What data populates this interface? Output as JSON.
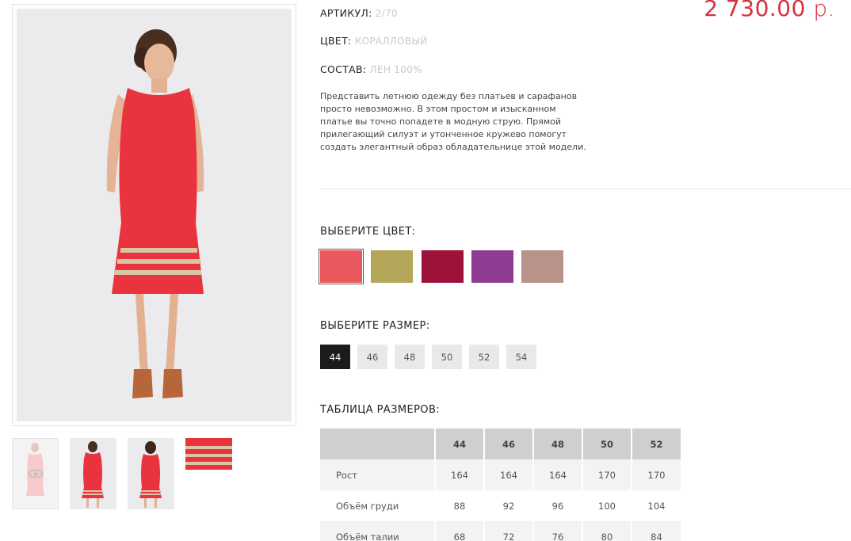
{
  "product": {
    "article_label": "АРТИКУЛ:",
    "article_value": "2/70",
    "color_label": "ЦВЕТ:",
    "color_value": "КОРАЛЛОВЫЙ",
    "composition_label": "СОСТАВ:",
    "composition_value": "ЛЕН 100%",
    "price_amount": "2 730.00",
    "price_currency": "р.",
    "description_lines": [
      "Представить летнюю одежду без платьев и сарафанов",
      "просто невозможно. В этом простом и изысканном",
      "платье вы точно попадете в модную струю. Прямой",
      "прилегающий силуэт и утонченное кружево помогут",
      "создать элегантный образ обладательнице этой модели."
    ]
  },
  "colors": {
    "title": "ВЫБЕРИТЕ ЦВЕТ:",
    "items": [
      "#e9585c",
      "#b3a659",
      "#9c1239",
      "#8e3b94",
      "#b8938a"
    ],
    "selected_index": 0
  },
  "sizes": {
    "title": "ВЫБЕРИТЕ РАЗМЕР:",
    "items": [
      "44",
      "46",
      "48",
      "50",
      "52",
      "54"
    ],
    "selected": "44"
  },
  "size_table": {
    "title": "ТАБЛИЦА РАЗМЕРОВ:",
    "headers": [
      "",
      "44",
      "46",
      "48",
      "50",
      "52"
    ],
    "rows": [
      {
        "label": "Рост",
        "values": [
          "164",
          "164",
          "164",
          "170",
          "170"
        ]
      },
      {
        "label": "Объём груди",
        "values": [
          "88",
          "92",
          "96",
          "100",
          "104"
        ]
      },
      {
        "label": "Объём талии",
        "values": [
          "68",
          "72",
          "76",
          "80",
          "84"
        ]
      }
    ]
  },
  "gallery": {
    "thumbnails": [
      "thumb-front-faded",
      "thumb-front",
      "thumb-back",
      "thumb-lace-detail"
    ],
    "eye_icon": "eye-icon"
  },
  "palette": {
    "accent": "#d5313d",
    "dress": "#e9343f",
    "lace": "#d8c5a4",
    "photo_bg": "#ebeaec"
  }
}
